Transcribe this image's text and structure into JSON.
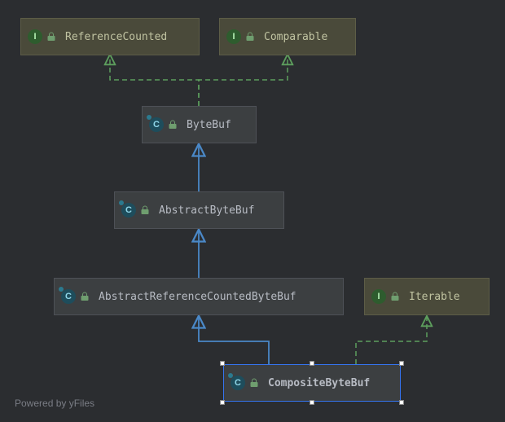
{
  "nodes": {
    "referenceCounted": {
      "label": "ReferenceCounted",
      "kind": "interface"
    },
    "comparable": {
      "label": "Comparable",
      "kind": "interface"
    },
    "byteBuf": {
      "label": "ByteBuf",
      "kind": "class"
    },
    "abstractByteBuf": {
      "label": "AbstractByteBuf",
      "kind": "class"
    },
    "abstractRefCounted": {
      "label": "AbstractReferenceCountedByteBuf",
      "kind": "class"
    },
    "iterable": {
      "label": "Iterable",
      "kind": "interface"
    },
    "compositeByteBuf": {
      "label": "CompositeByteBuf",
      "kind": "class",
      "selected": true
    }
  },
  "type_glyph": {
    "class": "C",
    "interface": "I"
  },
  "footer": "Powered by yFiles"
}
